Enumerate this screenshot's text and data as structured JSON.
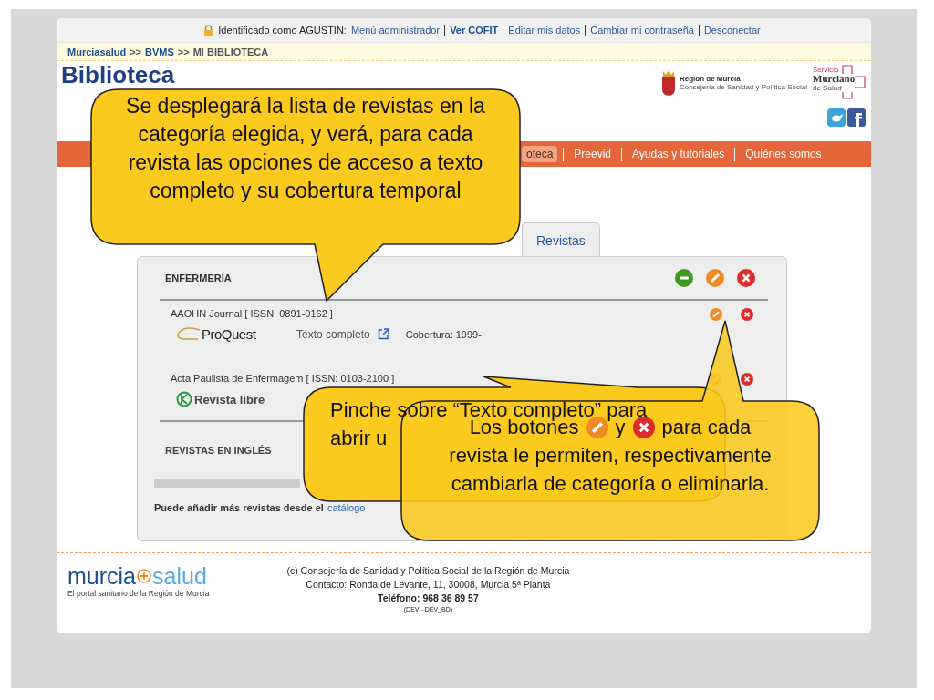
{
  "top_bar": {
    "greeting": "Identificado como AGUSTIN:",
    "links": [
      {
        "label": "Menú administrador",
        "bold": false
      },
      {
        "label": "Ver COFIT",
        "bold": true
      },
      {
        "label": "Editar mis datos",
        "bold": false
      },
      {
        "label": "Cambiar mi contraseña",
        "bold": false
      },
      {
        "label": "Desconectar",
        "bold": false
      }
    ]
  },
  "breadcrumb": {
    "separator": ">>",
    "items": [
      {
        "label": "Murciasalud",
        "link": true
      },
      {
        "label": "BVMS",
        "link": true
      },
      {
        "label": "MI BIBLIOTECA",
        "link": false
      }
    ]
  },
  "header": {
    "title": "Biblioteca",
    "region_logo": {
      "name": "Región de Murcia",
      "subtitle": "Consejería de Sanidad y Política Social"
    },
    "service_logo": {
      "line_1": "Servicio",
      "line_2": "Murciano",
      "line_3": "de Salud"
    }
  },
  "nav": [
    {
      "label": "oteca",
      "selected": true
    },
    {
      "label": "Preevid",
      "selected": false
    },
    {
      "label": "Ayudas y tutoriales",
      "selected": false
    },
    {
      "label": "Quiénes somos",
      "selected": false
    }
  ],
  "tabs": [
    {
      "label": "Revistas",
      "selected": true
    }
  ],
  "panel": {
    "categories": [
      {
        "title": "ENFERMERÍA",
        "expanded": true,
        "journals": [
          {
            "title": "AAOHN Journal [ ISSN: 0891-0162 ]",
            "provider": {
              "kind": "proquest",
              "label": "ProQuest"
            },
            "access": "Texto completo",
            "coverage": "Cobertura: 1999-"
          },
          {
            "title": "Acta Paulista de Enfermagem [ ISSN: 0103-2100 ]",
            "provider": {
              "kind": "free",
              "label": "Revista libre"
            }
          }
        ]
      },
      {
        "title": "REVISTAS EN INGLÉS",
        "expanded": false
      }
    ],
    "note": "Puede añadir más revistas desde el",
    "note_link": "catálogo"
  },
  "footer": {
    "logo": {
      "left": "murcia",
      "right": "salud",
      "tagline": "El portal sanitario de la Región de Murcia"
    },
    "lines": [
      {
        "kind": "normal",
        "text": "(c) Consejería de Sanidad y Política Social de la Región de Murcia"
      },
      {
        "kind": "normal",
        "text": "Contacto: Ronda de Levante, 11, 30008, Murcia 5ª Planta"
      },
      {
        "kind": "bold",
        "text": "Teléfono: 968 36 89 57"
      },
      {
        "kind": "small",
        "text": "(DEV - DEV_BD)"
      }
    ]
  },
  "callouts": [
    {
      "kind": "plain",
      "text": "Se desplegará la lista de revistas en la categoría elegida, y verá, para cada revista las opciones de acceso a texto completo y su cobertura temporal"
    },
    {
      "kind": "lines",
      "lines": [
        "Pinche sobre “Texto completo” para",
        "abrir u"
      ]
    },
    {
      "kind": "icons",
      "before": "Los botones",
      "between": "y",
      "after": "para cada",
      "rest": "revista le permiten, respectivamente cambiarla de categoría o eliminarla."
    }
  ]
}
